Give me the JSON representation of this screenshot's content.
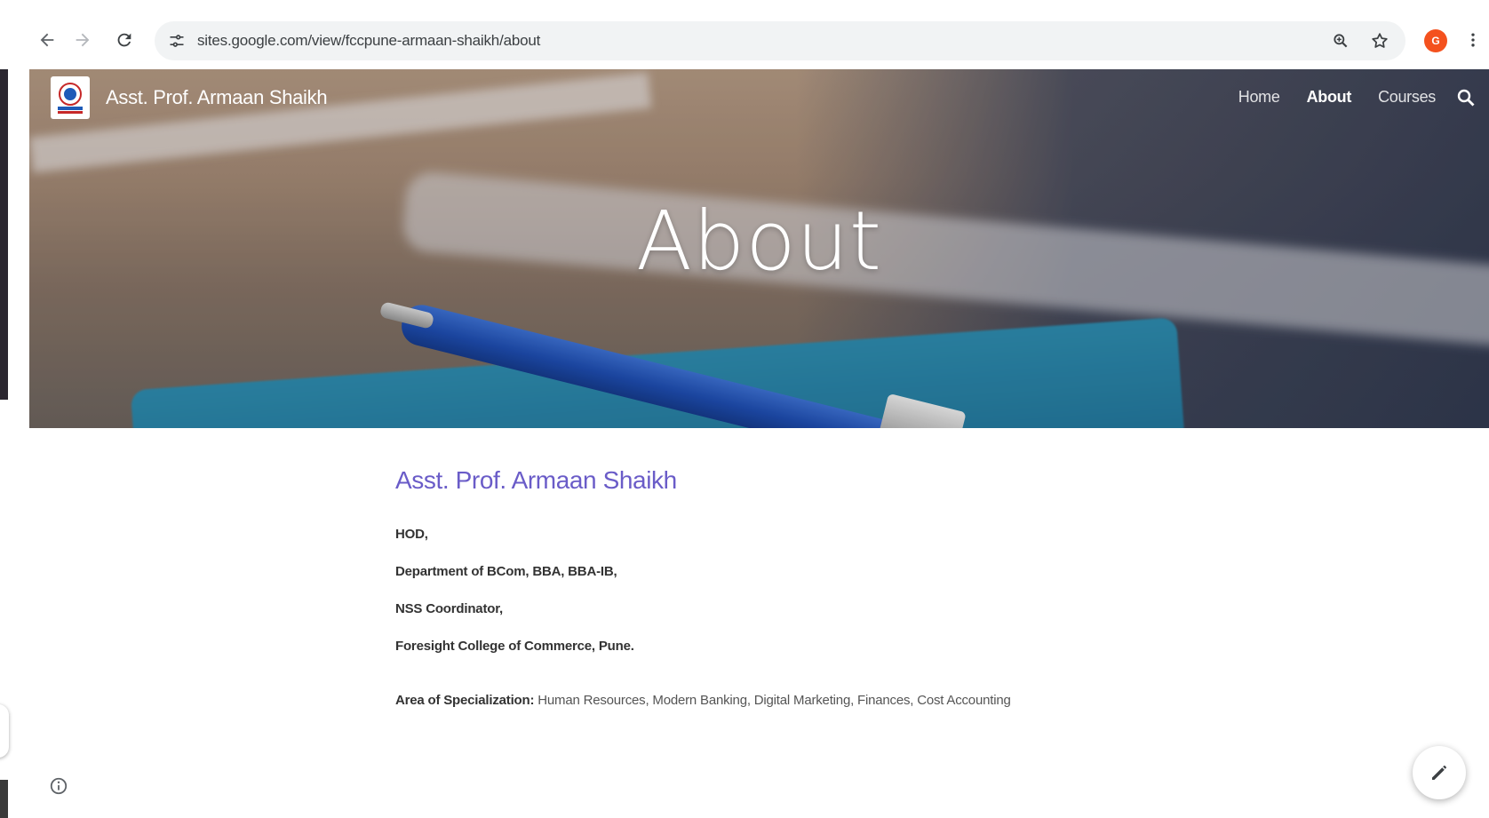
{
  "browser": {
    "url": "sites.google.com/view/fccpune-armaan-shaikh/about",
    "profile_initial": "G"
  },
  "site": {
    "name": "Asst. Prof. Armaan Shaikh",
    "nav": [
      {
        "label": "Home",
        "active": false
      },
      {
        "label": "About",
        "active": true
      },
      {
        "label": "Courses",
        "active": false
      }
    ]
  },
  "hero": {
    "title": "About"
  },
  "content": {
    "heading": "Asst. Prof. Armaan Shaikh",
    "lines": [
      "HOD,",
      "Department of BCom, BBA, BBA-IB,",
      "NSS Coordinator,",
      "Foresight College of Commerce, Pune."
    ],
    "specialization_label": "Area of Specialization:",
    "specialization_value": " Human Resources, Modern Banking, Digital Marketing, Finances, Cost Accounting"
  },
  "colors": {
    "heading": "#6a5cc8",
    "profile": "#f4511e"
  }
}
